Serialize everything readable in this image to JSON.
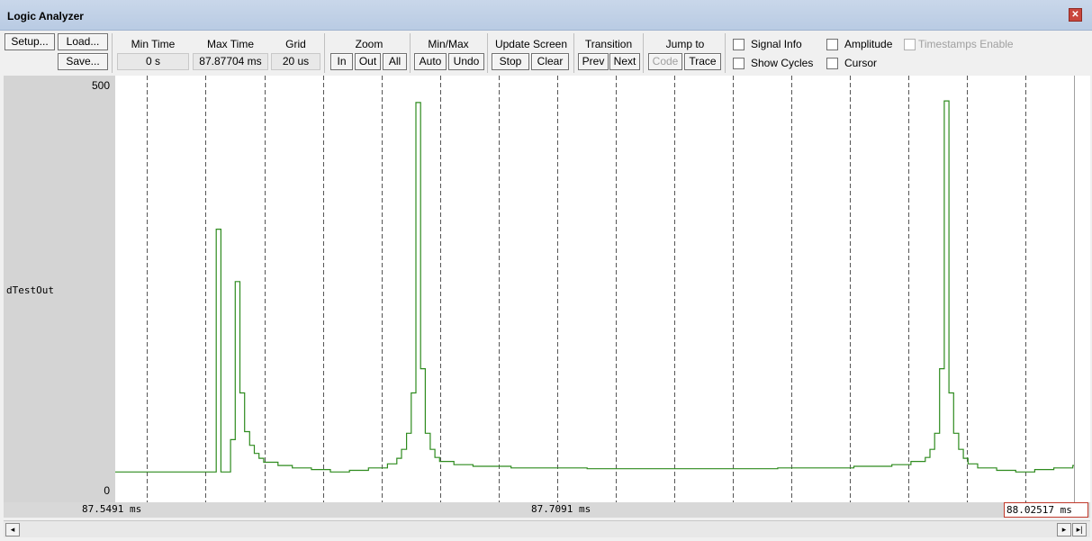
{
  "window": {
    "title": "Logic Analyzer"
  },
  "toolbar": {
    "setup_label": "Setup...",
    "load_label": "Load...",
    "save_label": "Save...",
    "min_time": {
      "label": "Min Time",
      "value": "0 s"
    },
    "max_time": {
      "label": "Max Time",
      "value": "87.87704 ms"
    },
    "grid": {
      "label": "Grid",
      "value": "20 us"
    },
    "zoom": {
      "label": "Zoom",
      "in": "In",
      "out": "Out",
      "all": "All"
    },
    "minmax": {
      "label": "Min/Max",
      "auto": "Auto",
      "undo": "Undo"
    },
    "update": {
      "label": "Update Screen",
      "stop": "Stop",
      "clear": "Clear"
    },
    "transition": {
      "label": "Transition",
      "prev": "Prev",
      "next": "Next"
    },
    "jump": {
      "label": "Jump to",
      "code": "Code",
      "trace": "Trace"
    },
    "options": {
      "signal_info": "Signal Info",
      "amplitude": "Amplitude",
      "timestamps_enable": "Timestamps Enable",
      "show_cycles": "Show Cycles",
      "cursor": "Cursor"
    }
  },
  "signal": {
    "name": "dTestOut",
    "max_label": "500",
    "min_label": "0",
    "line_color": "#2e8b1e"
  },
  "timebar": {
    "start": "87.5491 ms",
    "center": "87.7091 ms",
    "end": "88.02517 ms"
  },
  "scroll": {
    "left": "◂",
    "right": "▸",
    "end": "▸|"
  },
  "chart_data": {
    "type": "line",
    "series": [
      {
        "values": [
          [
            87.5491,
            22
          ],
          [
            87.5836,
            22
          ],
          [
            87.5836,
            323
          ],
          [
            87.5852,
            323
          ],
          [
            87.5852,
            22
          ],
          [
            87.5885,
            22
          ],
          [
            87.5885,
            62
          ],
          [
            87.5901,
            62
          ],
          [
            87.5901,
            258
          ],
          [
            87.5917,
            258
          ],
          [
            87.5917,
            120
          ],
          [
            87.5933,
            120
          ],
          [
            87.5933,
            72
          ],
          [
            87.595,
            72
          ],
          [
            87.595,
            55
          ],
          [
            87.5966,
            55
          ],
          [
            87.5966,
            45
          ],
          [
            87.5982,
            45
          ],
          [
            87.5982,
            39
          ],
          [
            87.5998,
            39
          ],
          [
            87.5998,
            34
          ],
          [
            87.6047,
            34
          ],
          [
            87.6047,
            30
          ],
          [
            87.6096,
            30
          ],
          [
            87.6096,
            27
          ],
          [
            87.6161,
            27
          ],
          [
            87.6161,
            25
          ],
          [
            87.6226,
            25
          ],
          [
            87.6226,
            22
          ],
          [
            87.6291,
            22
          ],
          [
            87.6291,
            24
          ],
          [
            87.6356,
            24
          ],
          [
            87.6356,
            27
          ],
          [
            87.6421,
            27
          ],
          [
            87.6421,
            32
          ],
          [
            87.6453,
            32
          ],
          [
            87.6453,
            39
          ],
          [
            87.6469,
            39
          ],
          [
            87.6469,
            50
          ],
          [
            87.6486,
            50
          ],
          [
            87.6486,
            70
          ],
          [
            87.6502,
            70
          ],
          [
            87.6502,
            120
          ],
          [
            87.6518,
            120
          ],
          [
            87.6518,
            480
          ],
          [
            87.6534,
            480
          ],
          [
            87.6534,
            150
          ],
          [
            87.655,
            150
          ],
          [
            87.655,
            70
          ],
          [
            87.6567,
            70
          ],
          [
            87.6567,
            50
          ],
          [
            87.6583,
            50
          ],
          [
            87.6583,
            40
          ],
          [
            87.6599,
            40
          ],
          [
            87.6599,
            35
          ],
          [
            87.6648,
            35
          ],
          [
            87.6648,
            31
          ],
          [
            87.6713,
            31
          ],
          [
            87.6713,
            29
          ],
          [
            87.6843,
            29
          ],
          [
            87.6843,
            27
          ],
          [
            87.7103,
            27
          ],
          [
            87.7103,
            26
          ],
          [
            87.7754,
            26
          ],
          [
            87.7754,
            27
          ],
          [
            87.8014,
            27
          ],
          [
            87.8014,
            29
          ],
          [
            87.8144,
            29
          ],
          [
            87.8144,
            31
          ],
          [
            87.8209,
            31
          ],
          [
            87.8209,
            35
          ],
          [
            87.8258,
            35
          ],
          [
            87.8258,
            40
          ],
          [
            87.8274,
            40
          ],
          [
            87.8274,
            50
          ],
          [
            87.829,
            50
          ],
          [
            87.829,
            70
          ],
          [
            87.8307,
            70
          ],
          [
            87.8307,
            150
          ],
          [
            87.8323,
            150
          ],
          [
            87.8323,
            482
          ],
          [
            87.8339,
            482
          ],
          [
            87.8339,
            120
          ],
          [
            87.8355,
            120
          ],
          [
            87.8355,
            70
          ],
          [
            87.8372,
            70
          ],
          [
            87.8372,
            50
          ],
          [
            87.8388,
            50
          ],
          [
            87.8388,
            39
          ],
          [
            87.8404,
            39
          ],
          [
            87.8404,
            32
          ],
          [
            87.8437,
            32
          ],
          [
            87.8437,
            27
          ],
          [
            87.8502,
            27
          ],
          [
            87.8502,
            24
          ],
          [
            87.8567,
            24
          ],
          [
            87.8567,
            22
          ],
          [
            87.8632,
            22
          ],
          [
            87.8632,
            25
          ],
          [
            87.8697,
            25
          ],
          [
            87.8697,
            27
          ],
          [
            87.8762,
            27
          ],
          [
            87.8762,
            30
          ],
          [
            87.8811,
            30
          ],
          [
            87.8811,
            34
          ],
          [
            87.886,
            34
          ],
          [
            87.886,
            39
          ],
          [
            87.8876,
            39
          ],
          [
            87.8876,
            45
          ],
          [
            87.8892,
            45
          ],
          [
            87.8892,
            55
          ],
          [
            87.8908,
            55
          ],
          [
            87.8908,
            72
          ],
          [
            87.8925,
            72
          ],
          [
            87.8925,
            120
          ],
          [
            87.8941,
            120
          ],
          [
            87.8941,
            258
          ],
          [
            87.8957,
            258
          ],
          [
            87.8957,
            120
          ],
          [
            87.8973,
            120
          ],
          [
            87.8973,
            70
          ],
          [
            87.899,
            70
          ],
          [
            87.899,
            50
          ],
          [
            87.9006,
            50
          ],
          [
            87.9006,
            38
          ],
          [
            87.9022,
            38
          ],
          [
            87.9022,
            30
          ],
          [
            87.9038,
            30
          ],
          [
            87.9038,
            24
          ],
          [
            87.9087,
            24
          ]
        ]
      }
    ],
    "xlim": [
      87.5491,
      87.8766
    ],
    "ylim": [
      0,
      500
    ],
    "grid": true
  }
}
